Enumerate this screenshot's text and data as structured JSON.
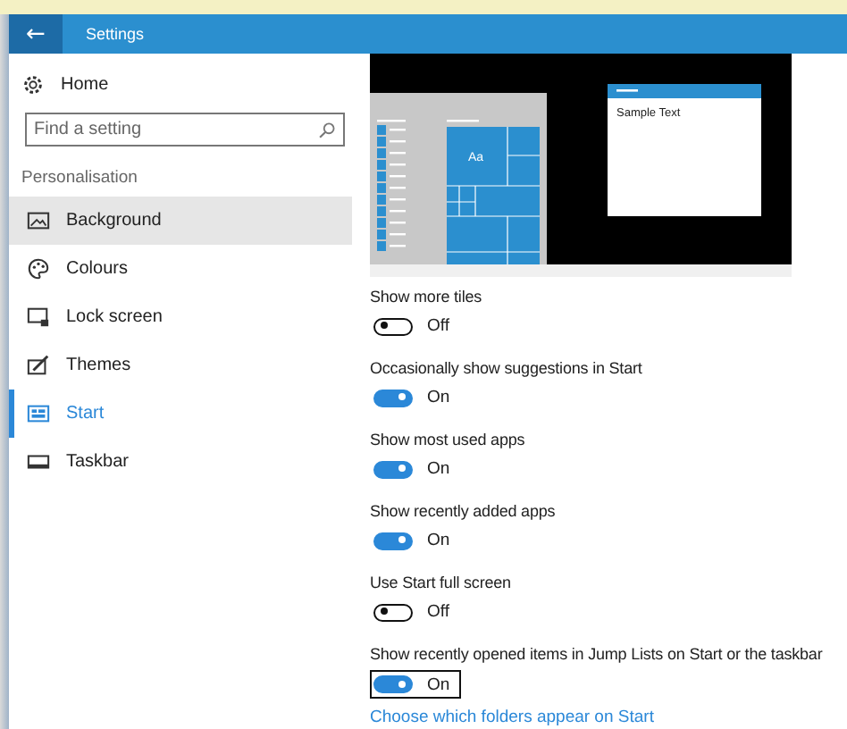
{
  "window": {
    "title": "Settings",
    "back": "←"
  },
  "sidebar": {
    "home": "Home",
    "search": {
      "placeholder": "Find a setting"
    },
    "section": "Personalisation",
    "items": [
      {
        "label": "Background",
        "selected": false,
        "hovered": true
      },
      {
        "label": "Colours",
        "selected": false,
        "hovered": false
      },
      {
        "label": "Lock screen",
        "selected": false,
        "hovered": false
      },
      {
        "label": "Themes",
        "selected": false,
        "hovered": false
      },
      {
        "label": "Start",
        "selected": true,
        "hovered": false
      },
      {
        "label": "Taskbar",
        "selected": false,
        "hovered": false
      }
    ]
  },
  "preview": {
    "tile_text": "Aa",
    "sample_text": "Sample Text"
  },
  "settings": [
    {
      "label": "Show more tiles",
      "on": false,
      "state_text": "Off",
      "focused": false
    },
    {
      "label": "Occasionally show suggestions in Start",
      "on": true,
      "state_text": "On",
      "focused": false
    },
    {
      "label": "Show most used apps",
      "on": true,
      "state_text": "On",
      "focused": false
    },
    {
      "label": "Show recently added apps",
      "on": true,
      "state_text": "On",
      "focused": false
    },
    {
      "label": "Use Start full screen",
      "on": false,
      "state_text": "Off",
      "focused": false
    },
    {
      "label": "Show recently opened items in Jump Lists on Start or the taskbar",
      "on": true,
      "state_text": "On",
      "focused": true
    }
  ],
  "link": "Choose which folders appear on Start"
}
